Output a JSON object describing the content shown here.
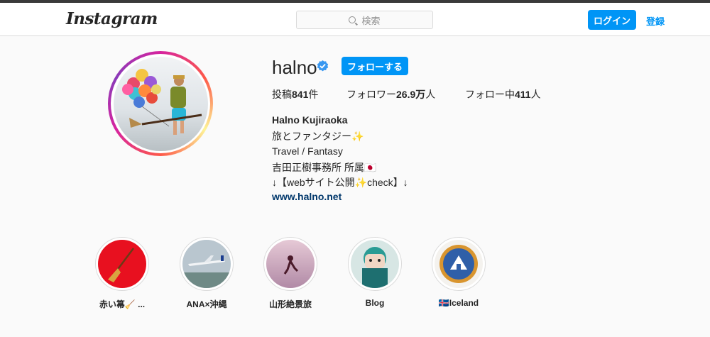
{
  "header": {
    "logo": "Instagram",
    "search_placeholder": "検索",
    "login_label": "ログイン",
    "register_label": "登録"
  },
  "profile": {
    "username": "halno",
    "follow_label": "フォローする",
    "stats": {
      "posts_prefix": "投稿",
      "posts_value": "841",
      "posts_suffix": "件",
      "followers_prefix": "フォロワー",
      "followers_value": "26.9万",
      "followers_suffix": "人",
      "following_prefix": "フォロー中",
      "following_value": "411",
      "following_suffix": "人"
    },
    "bio": {
      "name": "Halno Kujiraoka",
      "line1": "旅とファンタジー✨",
      "line2": "Travel / Fantasy",
      "line3": "吉田正樹事務所 所属🇯🇵",
      "line4": "↓【webサイト公開✨check】↓",
      "link": "www.halno.net"
    }
  },
  "highlights": [
    {
      "label": "赤い箒🧹 ..."
    },
    {
      "label": "ANA×沖縄"
    },
    {
      "label": "山形絶景旅"
    },
    {
      "label": "Blog"
    },
    {
      "label": "🇮🇸Iceland"
    }
  ],
  "colors": {
    "accent": "#0095f6",
    "verified": "#3897f0",
    "link": "#00376b"
  }
}
